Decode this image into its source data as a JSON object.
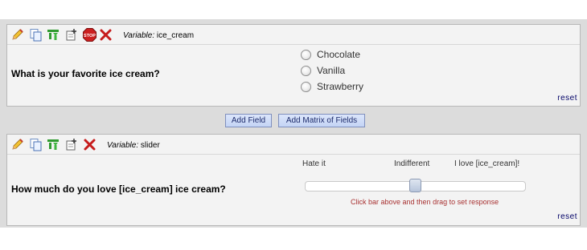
{
  "fields": [
    {
      "variable_prefix": "Variable:",
      "variable_name": "ice_cream",
      "question": "What is your favorite ice cream?",
      "options": [
        "Chocolate",
        "Vanilla",
        "Strawberry"
      ],
      "reset_label": "reset",
      "toolbar_icons": [
        "pencil-icon",
        "copy-icon",
        "branch-icon",
        "move-icon",
        "stop-icon",
        "delete-icon"
      ]
    },
    {
      "variable_prefix": "Variable:",
      "variable_name": "slider",
      "question": "How much do you love [ice_cream] ice cream?",
      "scale_labels": {
        "left": "Hate it",
        "middle": "Indifferent",
        "right": "I love [ice_cream]!"
      },
      "slider_value_fraction": 0.5,
      "slider_hint": "Click bar above and then drag to set response",
      "reset_label": "reset",
      "toolbar_icons": [
        "pencil-icon",
        "copy-icon",
        "branch-icon",
        "move-icon",
        "delete-icon"
      ]
    }
  ],
  "buttons": {
    "add_field": "Add Field",
    "add_matrix": "Add Matrix of Fields"
  },
  "colors": {
    "panel_bg": "#f3f3f3",
    "band_bg": "#dcdcdc",
    "button_bg": "#c9d7f6",
    "hint_text": "#a83232",
    "reset_link": "#000066"
  }
}
